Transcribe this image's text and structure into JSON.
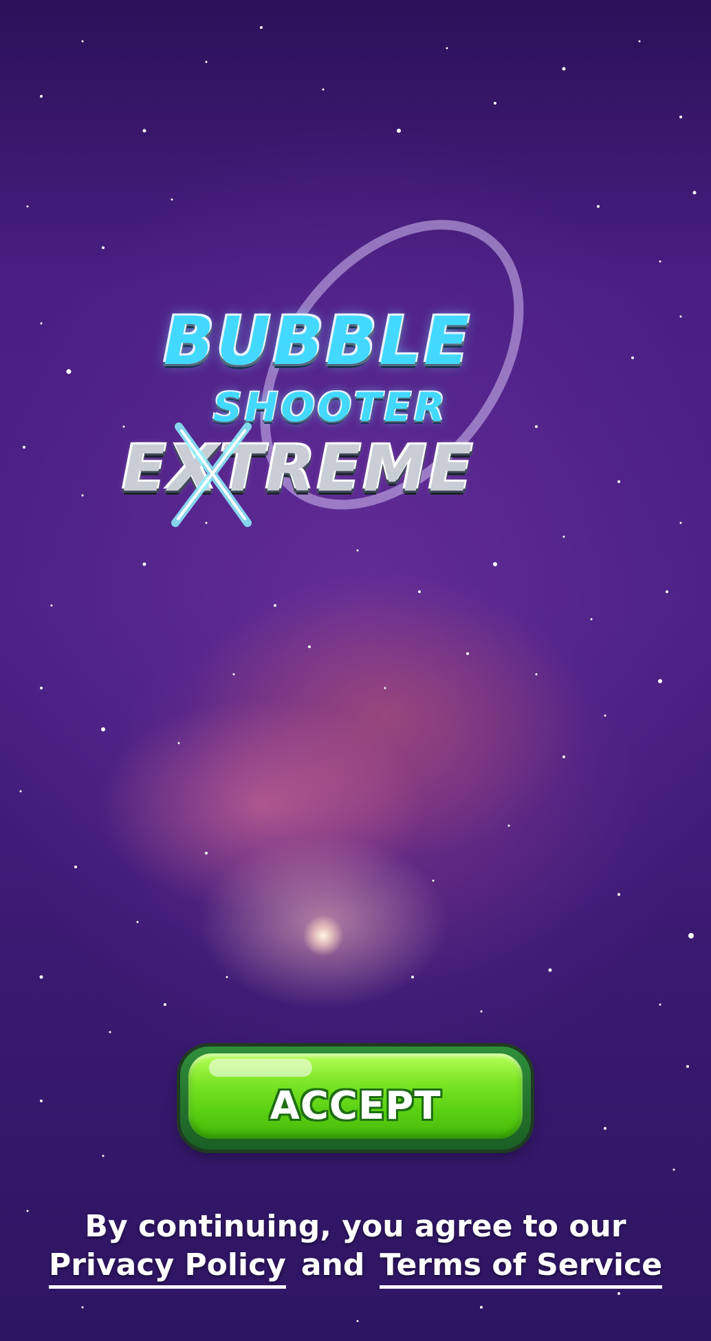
{
  "logo": {
    "line1": "BUBBLE",
    "line2": "SHOOTER",
    "line3": "EXTREME"
  },
  "accept_button": {
    "label": "ACCEPT"
  },
  "consent": {
    "intro": "By continuing, you agree to our",
    "privacy_link": "Privacy Policy",
    "conjunction": "and",
    "terms_link": "Terms of Service"
  },
  "colors": {
    "background": "#4a1f84",
    "logo_blue": "#43d9ff",
    "logo_silver": "#c9ced6",
    "button_green": "#7ae524",
    "button_outline": "#1e6e13",
    "text": "#ffffff"
  }
}
